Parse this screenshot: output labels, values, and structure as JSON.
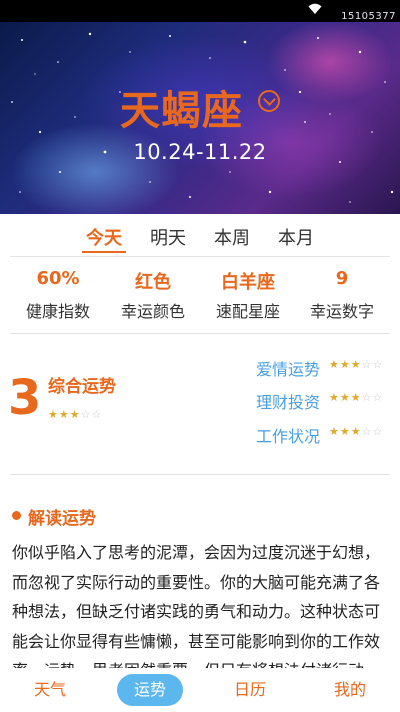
{
  "status_bar": {
    "clock": "15105377"
  },
  "header": {
    "sign_name": "天蝎座",
    "date_range": "10.24-11.22"
  },
  "tabs": [
    {
      "label": "今天",
      "active": true
    },
    {
      "label": "明天",
      "active": false
    },
    {
      "label": "本周",
      "active": false
    },
    {
      "label": "本月",
      "active": false
    }
  ],
  "stats": [
    {
      "value": "60%",
      "label": "健康指数"
    },
    {
      "value": "红色",
      "label": "幸运颜色"
    },
    {
      "value": "白羊座",
      "label": "速配星座"
    },
    {
      "value": "9",
      "label": "幸运数字"
    }
  ],
  "overall": {
    "score": "3",
    "label": "综合运势",
    "stars": 3,
    "max_stars": 5
  },
  "categories": [
    {
      "label": "爱情运势",
      "stars": 3,
      "max_stars": 5
    },
    {
      "label": "理财投资",
      "stars": 3,
      "max_stars": 5
    },
    {
      "label": "工作状况",
      "stars": 3,
      "max_stars": 5
    }
  ],
  "reading": {
    "title": "解读运势",
    "text": "你似乎陷入了思考的泥潭，会因为过度沉迷于幻想，而忽视了实际行动的重要性。你的大脑可能充满了各种想法，但缺乏付诸实践的勇气和动力。这种状态可能会让你显得有些慵懒，甚至可能影响到你的工作效率。运势，思考固然重要，但只有将想法付诸行动"
  },
  "bottom_nav": [
    {
      "label": "天气",
      "active": false
    },
    {
      "label": "运势",
      "active": true
    },
    {
      "label": "日历",
      "active": false
    },
    {
      "label": "我的",
      "active": false
    }
  ],
  "colors": {
    "accent": "#e8681e",
    "link_blue": "#4a9fe0",
    "star_gold": "#e0a92a",
    "nav_pill": "#5db7ef"
  },
  "icons": {
    "sign_toggle": "chevron-down-circle-icon",
    "wifi": "wifi-icon",
    "star": "star-icon"
  }
}
